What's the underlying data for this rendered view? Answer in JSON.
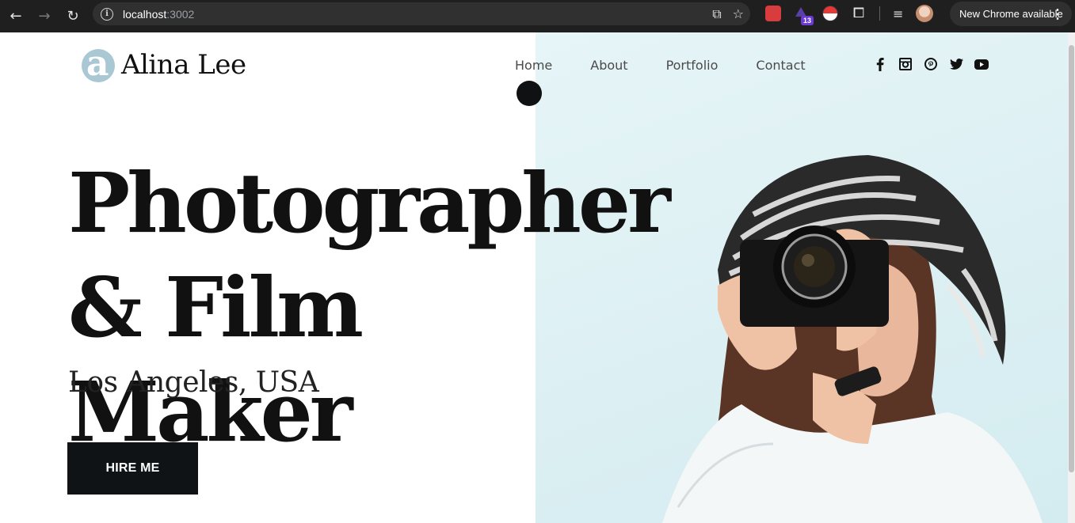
{
  "browser": {
    "url_host": "localhost",
    "url_port": ":3002",
    "update_label": "New Chrome available",
    "extension_badge": "13"
  },
  "site": {
    "logo_letter": "a",
    "logo_name": "Alina Lee",
    "nav": [
      "Home",
      "About",
      "Portfolio",
      "Contact"
    ],
    "social_icons": [
      "facebook-icon",
      "instagram-icon",
      "pinterest-icon",
      "twitter-icon",
      "youtube-icon"
    ]
  },
  "hero": {
    "headline_line1": "Photographer",
    "headline_line2": "& Film Maker",
    "location": "Los Angeles, USA",
    "cta_label": "HIRE ME"
  },
  "colors": {
    "accent": "#a9c8d3",
    "dark": "#0f1315",
    "photo_bg": "#dff1f4"
  }
}
